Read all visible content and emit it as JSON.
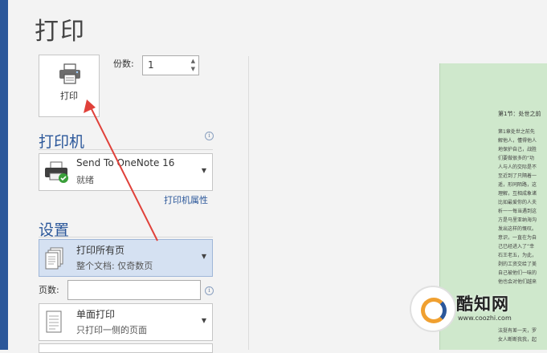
{
  "page_title": "打印",
  "print_button": {
    "label": "打印",
    "icon": "printer-icon"
  },
  "copies": {
    "label": "份数:",
    "value": "1"
  },
  "printer_section": {
    "heading": "打印机",
    "selected_name": "Send To OneNote 16",
    "selected_status": "就绪",
    "properties_link": "打印机属性",
    "icon": "printer-ready-icon"
  },
  "settings_section": {
    "heading": "设置",
    "range": {
      "main": "打印所有页",
      "sub": "整个文档: 仅奇数页"
    },
    "pages_label": "页数:",
    "pages_value": "",
    "sides": {
      "main": "单面打印",
      "sub": "只打印一侧的页面"
    }
  },
  "preview": {
    "heading": "第1节：处世之前",
    "lines": [
      "第1章处世之前先",
      "解他人，懂得他人",
      "地保护自己，战胜",
      "们要做很多的“功",
      "人与人的交际是不",
      "至近到了只隔着一",
      "遥，形同陌路，这",
      "理解，互相成象诸",
      "比如最爱你的人夫",
      "析一一每当遇到这",
      "方是马里亚纳海沟",
      "发出这样的慨叹。",
      "意识，一直在为自",
      "己已经进入了“幸",
      "石王老五，为此，",
      "剥的工资交给了美",
      "自己被他们一味的",
      "他也会对他们越来",
      "法挺有差一天，罗",
      "女人断断我我，起"
    ]
  },
  "watermark": {
    "brand": "酷知网",
    "url": "www.coozhi.com"
  },
  "colors": {
    "accent": "#2b579a",
    "selected": "#d5e1f2",
    "annotation_arrow": "#e0413a",
    "preview_page": "#cfe8cc"
  }
}
